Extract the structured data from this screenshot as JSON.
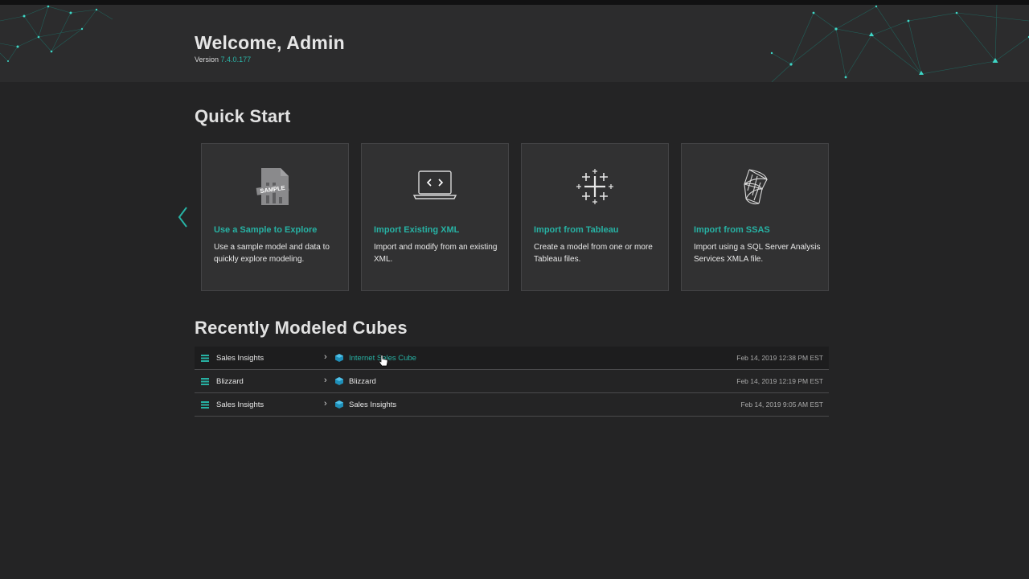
{
  "header": {
    "welcome": "Welcome, Admin",
    "version_label": "Version",
    "version_number": "7.4.0.177"
  },
  "quick_start": {
    "title": "Quick Start",
    "cards": [
      {
        "icon": "sample-document-icon",
        "title": "Use a Sample to Explore",
        "description": "Use a sample model and data to quickly explore modeling."
      },
      {
        "icon": "xml-laptop-icon",
        "title": "Import Existing XML",
        "description": "Import and modify from an existing XML."
      },
      {
        "icon": "tableau-icon",
        "title": "Import from Tableau",
        "description": "Create a model from one or more Tableau files."
      },
      {
        "icon": "ssas-icon",
        "title": "Import from SSAS",
        "description": "Import using a SQL Server Analysis Services XMLA file."
      }
    ],
    "sample_badge": "SAMPLE"
  },
  "recent": {
    "title": "Recently Modeled Cubes",
    "rows": [
      {
        "project": "Sales Insights",
        "cube": "Internet Sales Cube",
        "date": "Feb 14, 2019 12:38 PM EST"
      },
      {
        "project": "Blizzard",
        "cube": "Blizzard",
        "date": "Feb 14, 2019 12:19 PM EST"
      },
      {
        "project": "Sales Insights",
        "cube": "Sales Insights",
        "date": "Feb 14, 2019 9:05 AM EST"
      }
    ]
  },
  "colors": {
    "accent": "#27b2a4",
    "background": "#242425",
    "header": "#2c2c2d",
    "card": "#313132"
  }
}
